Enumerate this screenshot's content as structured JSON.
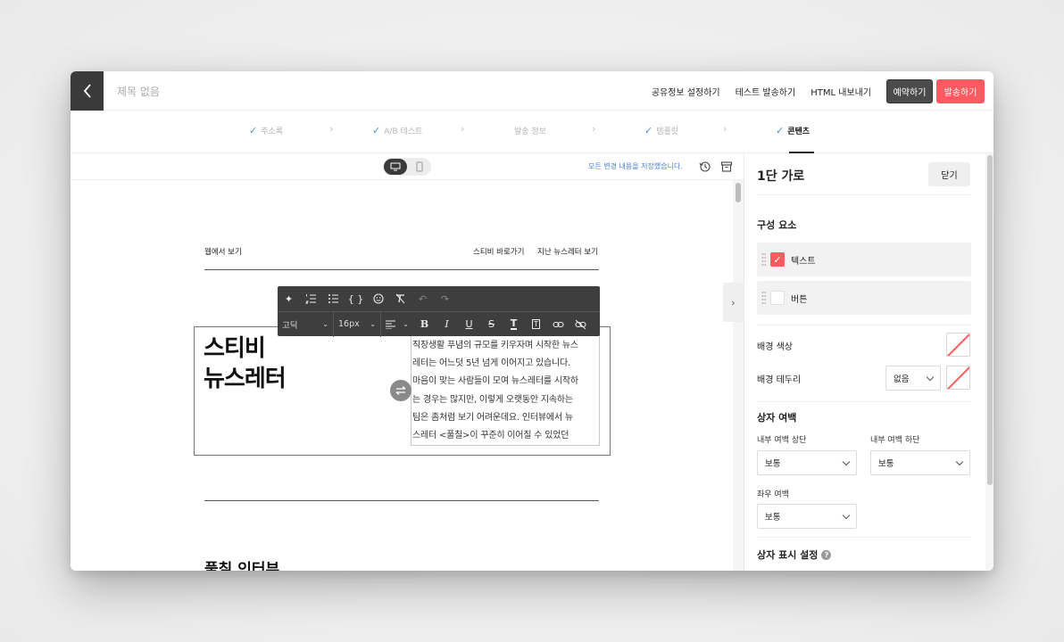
{
  "header": {
    "title": "제목 없음",
    "links": [
      "공유정보 설정하기",
      "테스트 발송하기",
      "HTML 내보내기"
    ],
    "schedule_label": "예약하기",
    "send_label": "발송하기"
  },
  "steps": [
    {
      "label": "주소록",
      "done": true
    },
    {
      "label": "A/B 테스트",
      "done": true
    },
    {
      "label": "발송 정보",
      "done": false
    },
    {
      "label": "템플릿",
      "done": true
    },
    {
      "label": "콘텐츠",
      "done": true,
      "active": true
    }
  ],
  "editor": {
    "save_status": "모든 변경 내용을 저장했습니다.",
    "view_on_web": "웹에서 보기",
    "stibee_link": "스티비 바로가기",
    "past_newsletters": "지난 뉴스레터 보기",
    "headline_line1": "스티비",
    "headline_line2": "뉴스레터",
    "body_lines": [
      "직장생활 푸념의 규모를 키우자며 시작한 뉴스",
      "레터는 어느덧 5년 넘게 이어지고 있습니다.",
      "마음이 맞는 사람들이 모여 뉴스레터를 시작하",
      "는 경우는 많지만, 이렇게 오랫동안 지속하는",
      "팀은 좀처럼 보기 어려운데요. 인터뷰에서 뉴",
      "스레터 <풀칠>이 꾸준히 이어질 수 있었던"
    ],
    "next_heading": "풀칠 인터뷰"
  },
  "toolbar": {
    "font_family": "고딕",
    "font_size": "16px",
    "row1_icons": [
      "ai-sparkle-icon",
      "ordered-list-icon",
      "bullet-list-icon",
      "code-braces-icon",
      "emoji-icon",
      "clear-format-icon",
      "undo-icon",
      "redo-icon"
    ],
    "row2_icons": [
      "align-icon",
      "bold-icon",
      "italic-icon",
      "underline-icon",
      "strikethrough-icon",
      "text-color-icon",
      "text-background-icon",
      "link-icon",
      "unlink-icon"
    ]
  },
  "panel": {
    "title": "1단 가로",
    "close_label": "닫기",
    "components_label": "구성 요소",
    "components": [
      {
        "label": "텍스트",
        "checked": true
      },
      {
        "label": "버튼",
        "checked": false
      }
    ],
    "bg_color_label": "배경 색상",
    "bg_border_label": "배경 테두리",
    "bg_border_value": "없음",
    "box_padding_label": "상자 여백",
    "padding_top_label": "내부 여백 상단",
    "padding_top_value": "보통",
    "padding_bottom_label": "내부 여백 하단",
    "padding_bottom_value": "보통",
    "padding_side_label": "좌우 여백",
    "padding_side_value": "보통",
    "box_display_label": "상자 표시 설정"
  },
  "colors": {
    "accent": "#ff5a5f",
    "dark": "#3a3a3a",
    "check": "#4a90e2"
  }
}
